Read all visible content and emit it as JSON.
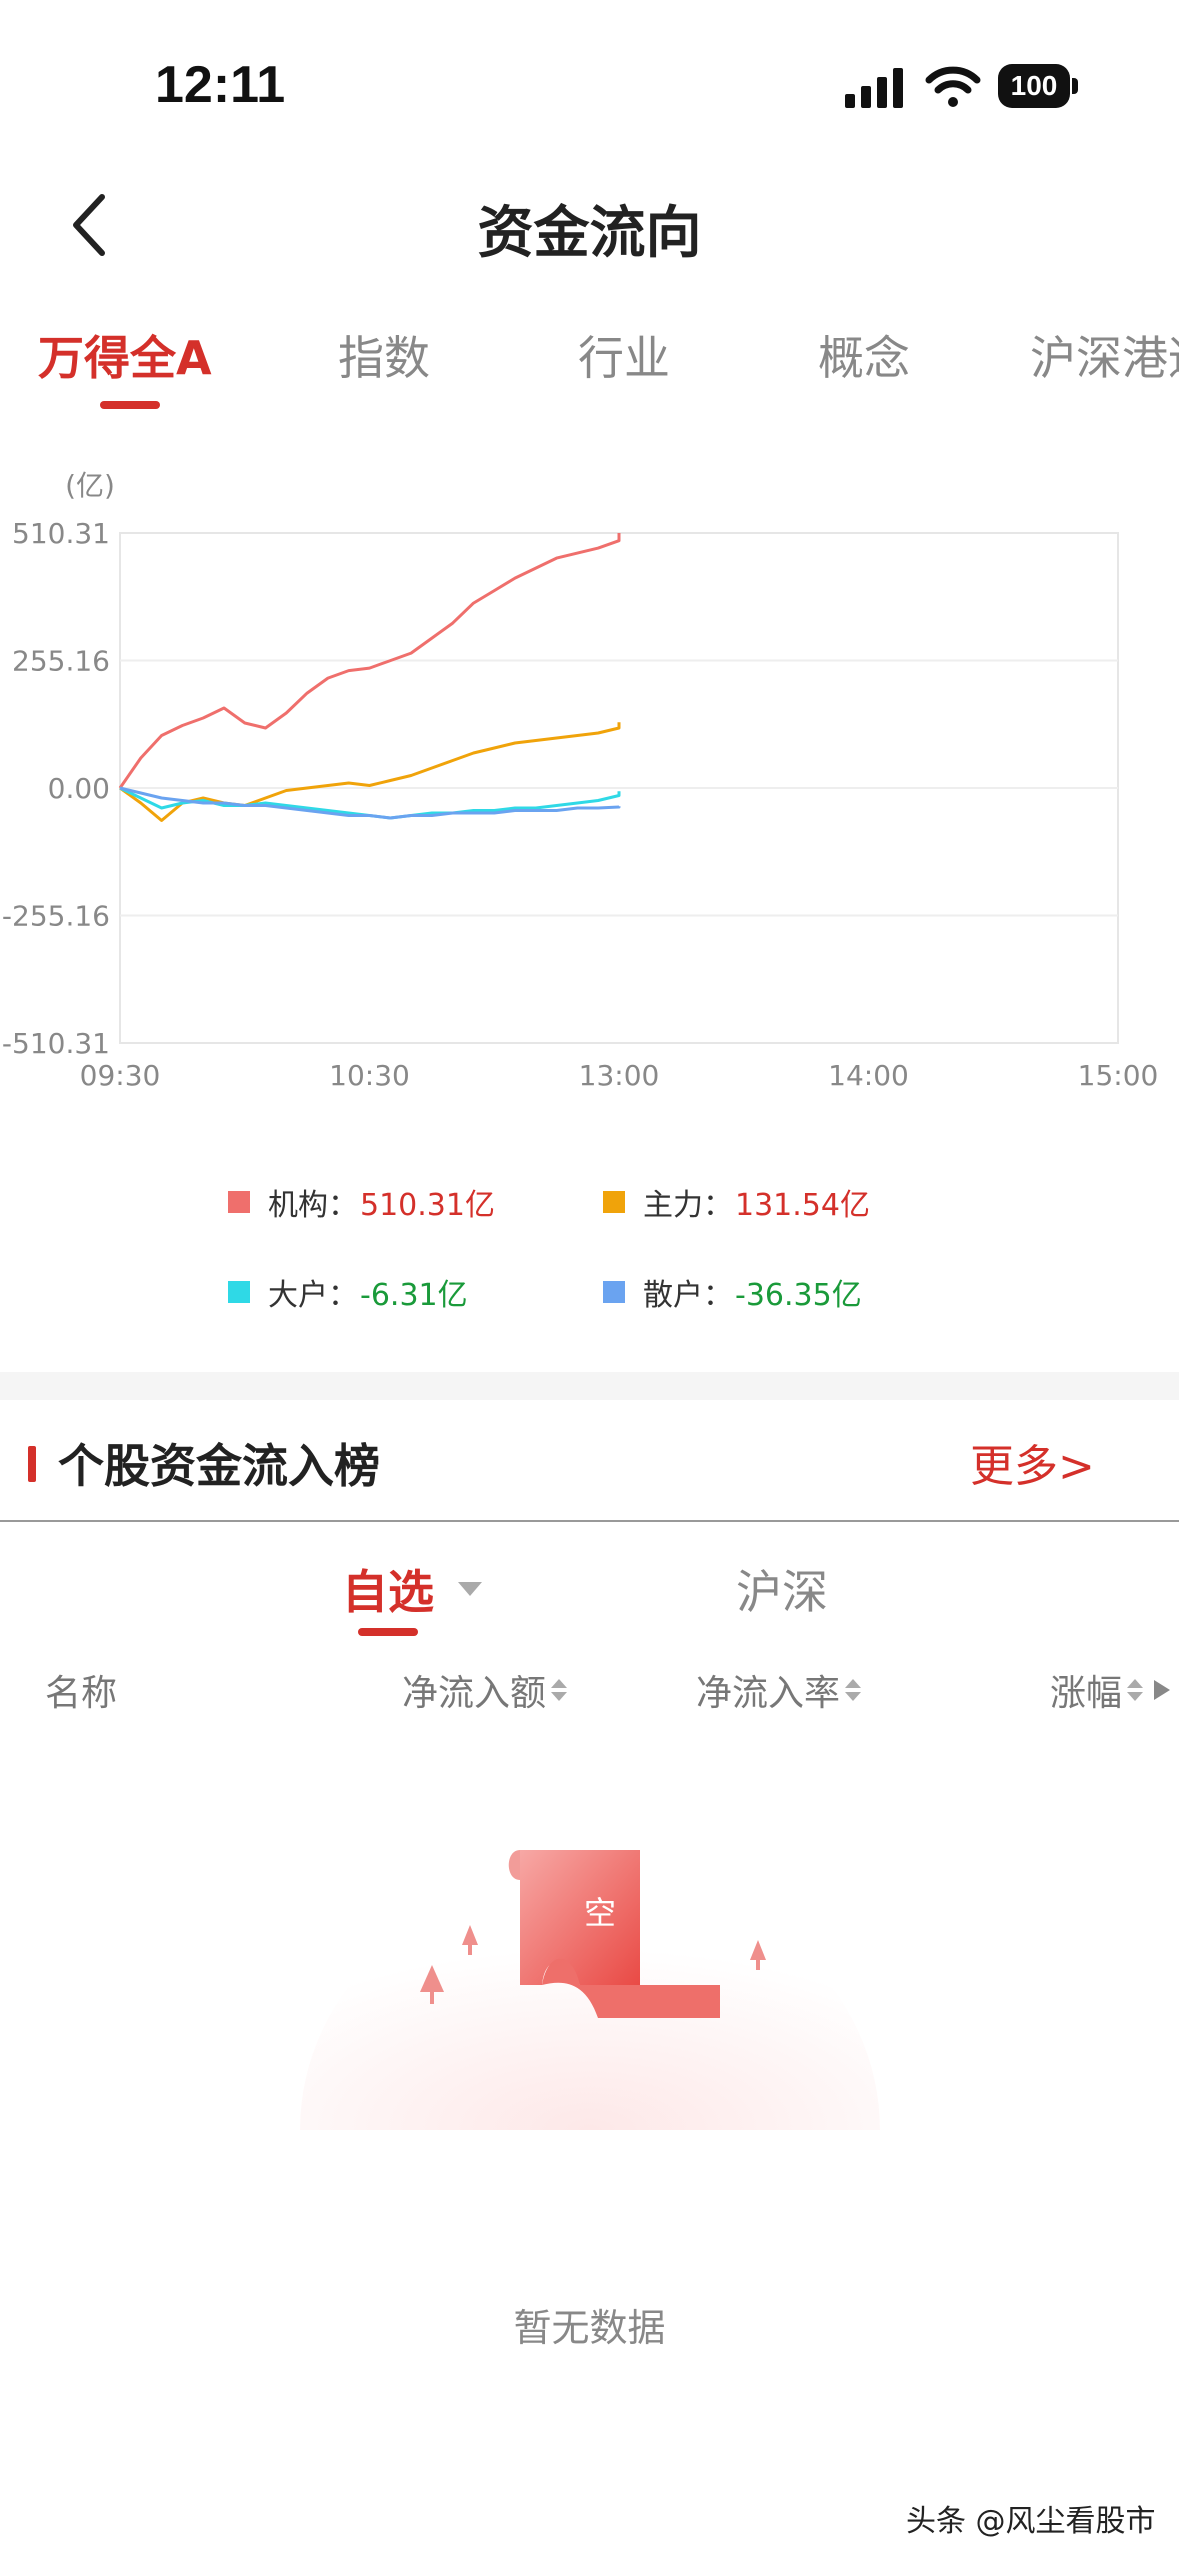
{
  "status_bar": {
    "time": "12:11",
    "battery": "100"
  },
  "nav": {
    "title": "资金流向",
    "back_icon": "chevron-left-icon"
  },
  "tabs": [
    {
      "label": "万得全A",
      "active": true
    },
    {
      "label": "指数",
      "active": false
    },
    {
      "label": "行业",
      "active": false
    },
    {
      "label": "概念",
      "active": false
    },
    {
      "label": "沪深港通",
      "active": false
    }
  ],
  "chart_data": {
    "type": "line",
    "unit_label": "(亿)",
    "y_ticks": [
      "510.31",
      "255.16",
      "0.00",
      "-255.16",
      "-510.31"
    ],
    "ylim": [
      -510.31,
      510.31
    ],
    "x_ticks": [
      "09:30",
      "10:30",
      "13:00",
      "14:00",
      "15:00"
    ],
    "grid": true,
    "x": [
      "09:30",
      "09:35",
      "09:40",
      "09:45",
      "09:50",
      "09:55",
      "10:00",
      "10:05",
      "10:10",
      "10:15",
      "10:20",
      "10:25",
      "10:30",
      "10:35",
      "10:40",
      "10:45",
      "10:50",
      "10:55",
      "11:00",
      "11:05",
      "11:10",
      "11:15",
      "11:20",
      "11:25",
      "11:30",
      "13:00"
    ],
    "series": [
      {
        "name": "机构",
        "color": "#ef6f6c",
        "values": [
          0,
          60,
          105,
          125,
          140,
          160,
          130,
          120,
          150,
          190,
          220,
          235,
          240,
          255,
          270,
          300,
          330,
          370,
          395,
          420,
          440,
          460,
          470,
          480,
          495,
          510.31
        ]
      },
      {
        "name": "主力",
        "color": "#f0a30a",
        "values": [
          0,
          -30,
          -65,
          -30,
          -20,
          -30,
          -35,
          -20,
          -5,
          0,
          5,
          10,
          5,
          15,
          25,
          40,
          55,
          70,
          80,
          90,
          95,
          100,
          105,
          110,
          120,
          131.54
        ]
      },
      {
        "name": "大户",
        "color": "#2fd9e6",
        "values": [
          0,
          -20,
          -40,
          -30,
          -25,
          -35,
          -35,
          -30,
          -35,
          -40,
          -45,
          -50,
          -55,
          -60,
          -55,
          -50,
          -50,
          -45,
          -45,
          -40,
          -40,
          -35,
          -30,
          -25,
          -15,
          -6.31
        ]
      },
      {
        "name": "散户",
        "color": "#6aa3f0",
        "values": [
          0,
          -10,
          -20,
          -25,
          -30,
          -30,
          -35,
          -35,
          -40,
          -45,
          -50,
          -55,
          -55,
          -60,
          -55,
          -55,
          -50,
          -50,
          -50,
          -45,
          -45,
          -45,
          -40,
          -40,
          -38,
          -36.35
        ]
      }
    ]
  },
  "legend": [
    {
      "name": "机构",
      "value": "510.31亿",
      "color": "#ef6f6c",
      "value_color": "#d4302a"
    },
    {
      "name": "主力",
      "value": "131.54亿",
      "color": "#f0a30a",
      "value_color": "#d4302a"
    },
    {
      "name": "大户",
      "value": "-6.31亿",
      "color": "#2fd9e6",
      "value_color": "#1a9a3a"
    },
    {
      "name": "散户",
      "value": "-36.35亿",
      "color": "#6aa3f0",
      "value_color": "#1a9a3a"
    }
  ],
  "section": {
    "title": "个股资金流入榜",
    "more": "更多>"
  },
  "subtabs": [
    {
      "label": "自选",
      "active": true
    },
    {
      "label": "沪深",
      "active": false
    }
  ],
  "columns": [
    "名称",
    "净流入额",
    "净流入率",
    "涨幅"
  ],
  "empty": {
    "badge": "空",
    "message": "暂无数据"
  },
  "watermark": "头条 @风尘看股市"
}
